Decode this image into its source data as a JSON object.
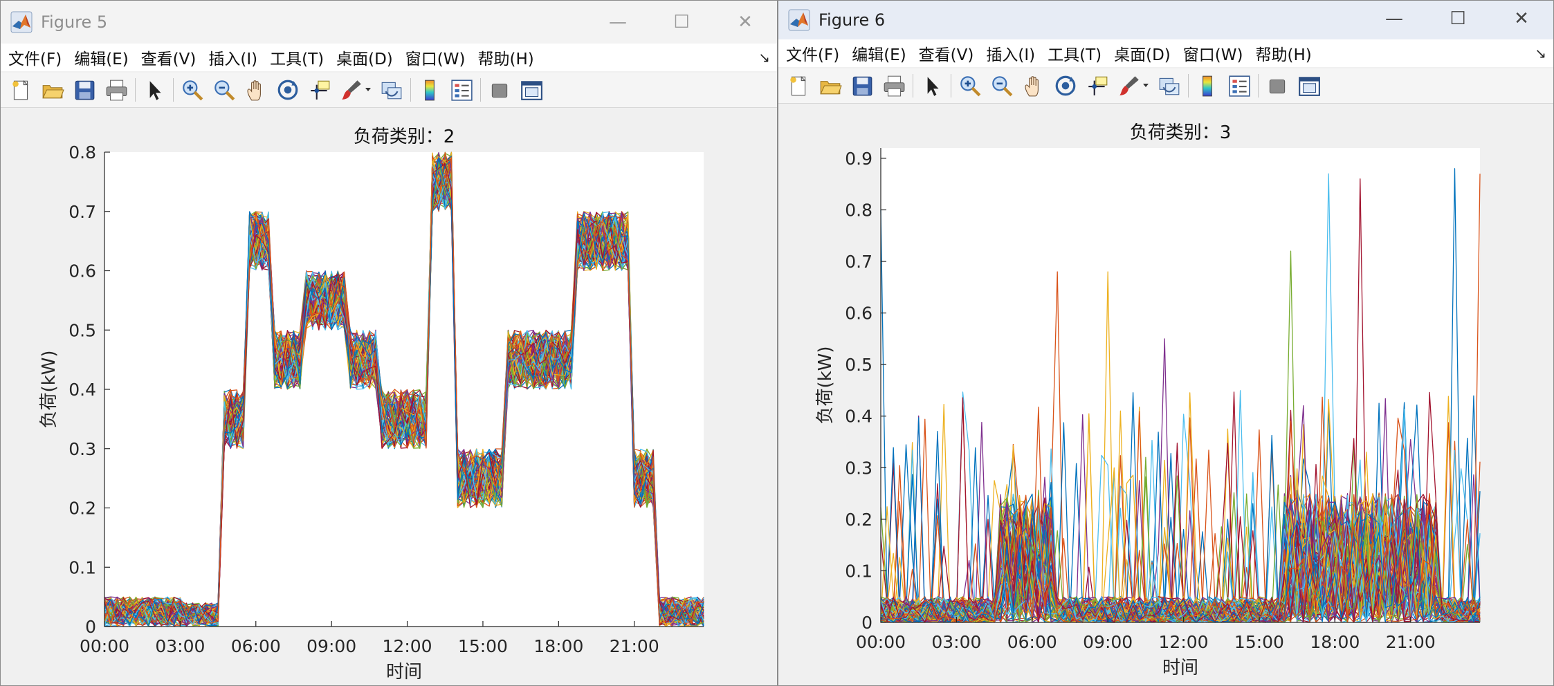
{
  "windows": [
    {
      "id": "win5",
      "title": "Figure 5",
      "controls": {
        "minimize": "—",
        "maximize": "☐",
        "close": "✕"
      },
      "menus": [
        "文件(F)",
        "编辑(E)",
        "查看(V)",
        "插入(I)",
        "工具(T)",
        "桌面(D)",
        "窗口(W)",
        "帮助(H)"
      ]
    },
    {
      "id": "win6",
      "title": "Figure 6",
      "controls": {
        "minimize": "—",
        "maximize": "☐",
        "close": "✕"
      },
      "menus": [
        "文件(F)",
        "编辑(E)",
        "查看(V)",
        "插入(I)",
        "工具(T)",
        "桌面(D)",
        "窗口(W)",
        "帮助(H)"
      ]
    }
  ],
  "toolbar_icons": [
    "new-figure-icon",
    "open-file-icon",
    "save-icon",
    "print-icon",
    "select-arrow-icon",
    "zoom-in-icon",
    "zoom-out-icon",
    "pan-hand-icon",
    "rotate-3d-icon",
    "data-cursor-icon",
    "brush-icon",
    "link-plot-icon",
    "colorbar-icon",
    "legend-icon",
    "hide-tools-icon",
    "show-tools-icon"
  ],
  "colors": {
    "matlab_cycle": [
      "#0072BD",
      "#D95319",
      "#EDB120",
      "#7E2F8E",
      "#77AC30",
      "#4DBEEE",
      "#A2142F"
    ],
    "axes_bg": "#ffffff",
    "figure_bg": "#f0f0f0"
  },
  "chart_data": [
    {
      "type": "line",
      "title": "负荷类别：2",
      "xlabel": "时间",
      "ylabel": "负荷(kW)",
      "xlim": [
        "00:00",
        "23:45"
      ],
      "ylim": [
        0,
        0.8
      ],
      "yticks": [
        "0",
        "0.1",
        "0.2",
        "0.3",
        "0.4",
        "0.5",
        "0.6",
        "0.7",
        "0.8"
      ],
      "xticks": [
        "00:00",
        "03:00",
        "06:00",
        "09:00",
        "12:00",
        "15:00",
        "18:00",
        "21:00"
      ],
      "grid": false,
      "num_series": 100,
      "sampling": "15-minute, 96 points per curve",
      "profile_bands": [
        {
          "from": "00:00",
          "to": "03:00",
          "min": 0.0,
          "max": 0.05
        },
        {
          "from": "03:00",
          "to": "04:30",
          "min": 0.0,
          "max": 0.04
        },
        {
          "from": "04:45",
          "to": "05:30",
          "min": 0.3,
          "max": 0.4
        },
        {
          "from": "05:45",
          "to": "06:30",
          "min": 0.6,
          "max": 0.7
        },
        {
          "from": "06:45",
          "to": "07:45",
          "min": 0.4,
          "max": 0.5
        },
        {
          "from": "08:00",
          "to": "09:30",
          "min": 0.5,
          "max": 0.6
        },
        {
          "from": "09:45",
          "to": "10:45",
          "min": 0.4,
          "max": 0.5
        },
        {
          "from": "11:00",
          "to": "12:45",
          "min": 0.3,
          "max": 0.4
        },
        {
          "from": "13:00",
          "to": "13:45",
          "min": 0.7,
          "max": 0.8
        },
        {
          "from": "14:00",
          "to": "15:45",
          "min": 0.2,
          "max": 0.3
        },
        {
          "from": "16:00",
          "to": "18:30",
          "min": 0.4,
          "max": 0.5
        },
        {
          "from": "18:45",
          "to": "20:45",
          "min": 0.6,
          "max": 0.7
        },
        {
          "from": "21:00",
          "to": "21:45",
          "min": 0.2,
          "max": 0.3
        },
        {
          "from": "22:00",
          "to": "22:45",
          "min": 0.0,
          "max": 0.05
        },
        {
          "from": "23:00",
          "to": "23:45",
          "min": 0.0,
          "max": 0.05
        }
      ]
    },
    {
      "type": "line",
      "title": "负荷类别：3",
      "xlabel": "时间",
      "ylabel": "负荷(kW)",
      "xlim": [
        "00:00",
        "23:45"
      ],
      "ylim": [
        0,
        0.92
      ],
      "yticks": [
        "0",
        "0.1",
        "0.2",
        "0.3",
        "0.4",
        "0.5",
        "0.6",
        "0.7",
        "0.8",
        "0.9"
      ],
      "xticks": [
        "00:00",
        "03:00",
        "06:00",
        "09:00",
        "12:00",
        "15:00",
        "18:00",
        "21:00"
      ],
      "grid": false,
      "num_series": 100,
      "sampling": "15-minute, 96 points per curve",
      "profile_bands": [
        {
          "from": "00:00",
          "to": "04:30",
          "min": 0.0,
          "max": 0.05
        },
        {
          "from": "04:45",
          "to": "06:45",
          "min": 0.0,
          "max": 0.25
        },
        {
          "from": "07:00",
          "to": "15:45",
          "min": 0.0,
          "max": 0.05
        },
        {
          "from": "16:00",
          "to": "22:00",
          "min": 0.0,
          "max": 0.25
        },
        {
          "from": "22:15",
          "to": "23:45",
          "min": 0.0,
          "max": 0.05
        }
      ],
      "notable_peaks": [
        {
          "x": "00:00",
          "y": 0.8
        },
        {
          "x": "07:00",
          "y": 0.68
        },
        {
          "x": "09:00",
          "y": 0.68
        },
        {
          "x": "11:15",
          "y": 0.55
        },
        {
          "x": "16:15",
          "y": 0.72
        },
        {
          "x": "17:45",
          "y": 0.87
        },
        {
          "x": "19:00",
          "y": 0.86
        },
        {
          "x": "22:45",
          "y": 0.88
        },
        {
          "x": "23:45",
          "y": 0.87
        }
      ]
    }
  ]
}
